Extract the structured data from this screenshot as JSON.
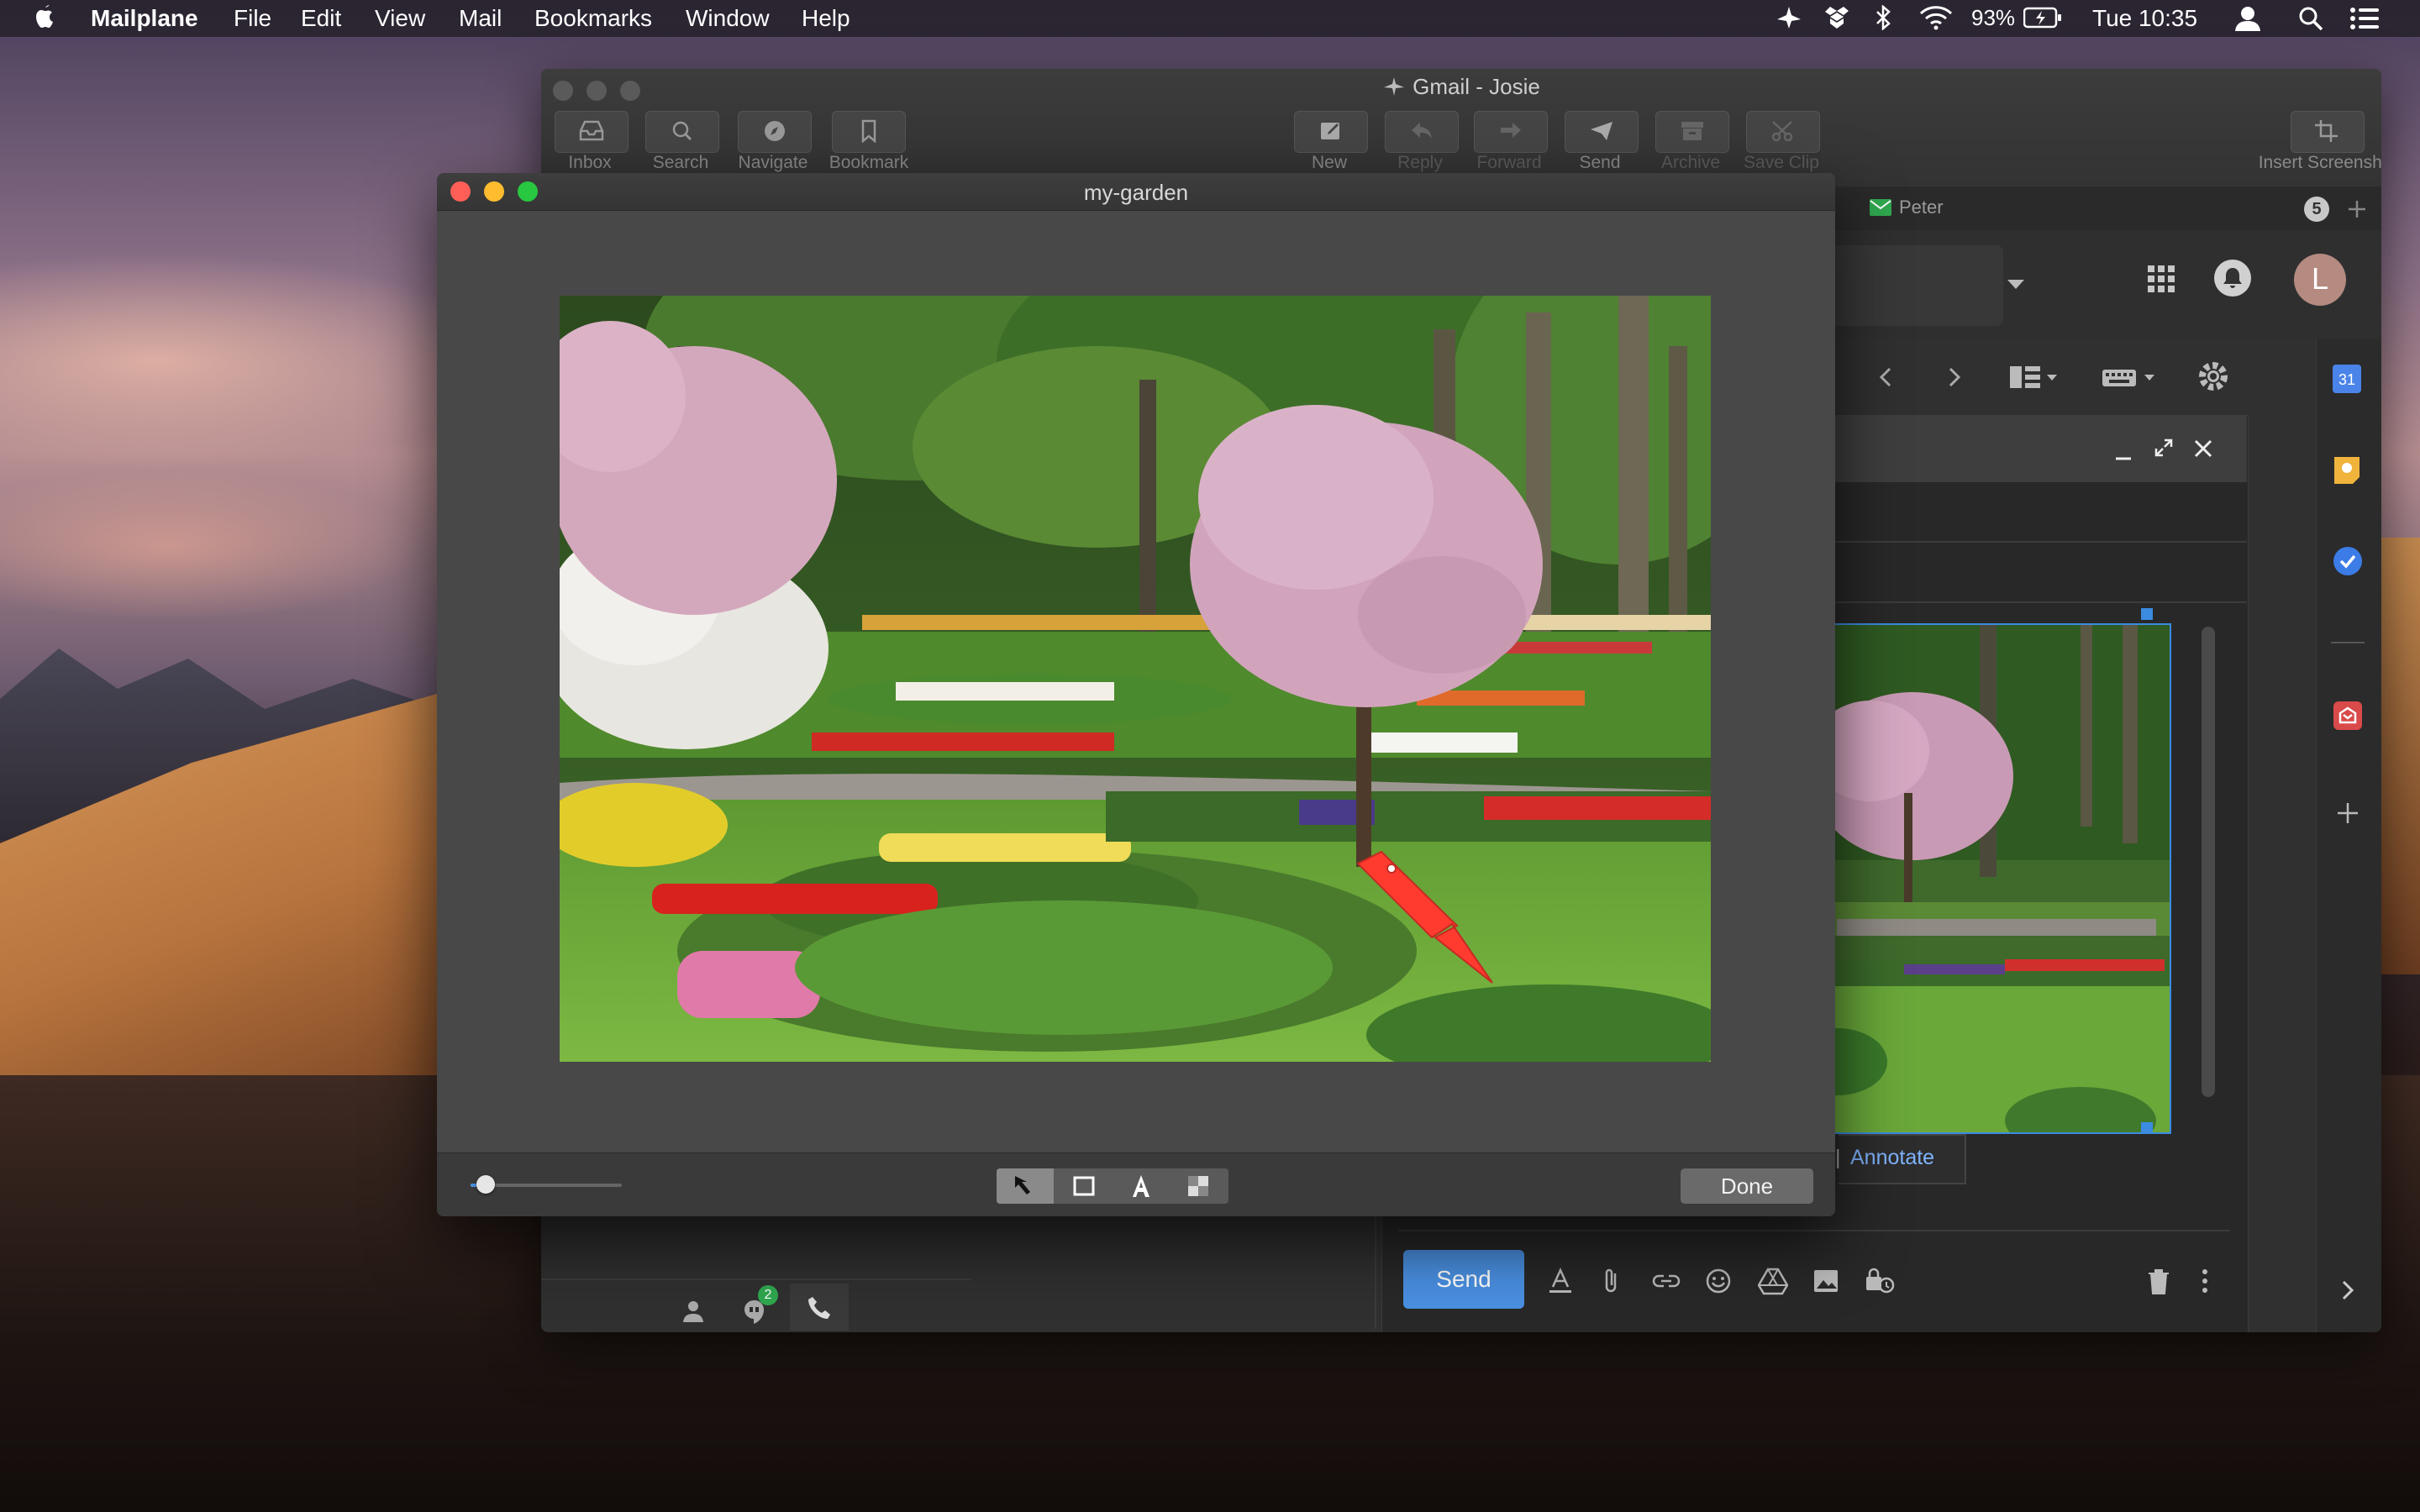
{
  "menubar": {
    "app_name": "Mailplane",
    "menus": [
      "File",
      "Edit",
      "View",
      "Mail",
      "Bookmarks",
      "Window",
      "Help"
    ],
    "battery": "93%",
    "clock": "Tue 10:35"
  },
  "mail_window": {
    "title": "Gmail - Josie",
    "toolbar": {
      "inbox": "Inbox",
      "search": "Search",
      "navigate": "Navigate",
      "bookmark": "Bookmark",
      "new": "New",
      "reply": "Reply",
      "forward": "Forward",
      "send": "Send",
      "archive": "Archive",
      "save_clip": "Save Clip",
      "insert_screenshot": "Insert Screenshot"
    },
    "tab": {
      "label": "Peter",
      "count": "5"
    },
    "avatar_letter": "L",
    "calendar_day": "31",
    "compose": {
      "annotate": "Annotate",
      "send": "Send"
    },
    "chat_badge": "2"
  },
  "editor": {
    "title": "my-garden",
    "zoom_level": 0.1,
    "done": "Done"
  },
  "colors": {
    "accent": "#4a90e2",
    "close": "#ff5f57",
    "minimize": "#febc2e",
    "zoom": "#28c840",
    "arrow": "#ff3b30"
  }
}
